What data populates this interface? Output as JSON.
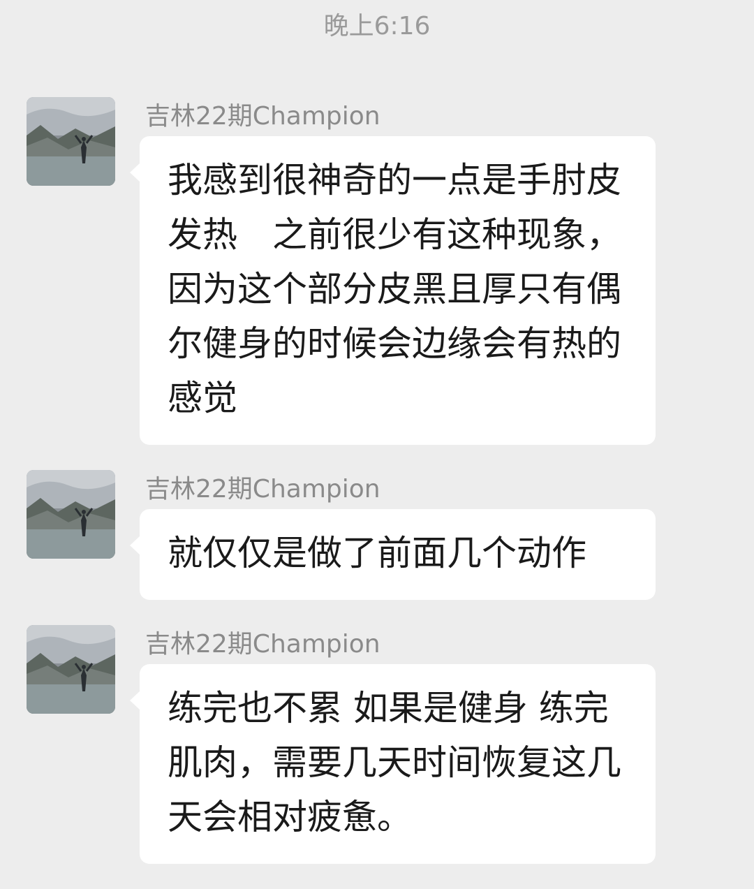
{
  "chat": {
    "timestamp": "晚上6:16",
    "messages": [
      {
        "sender": "吉林22期Champion",
        "text": "我感到很神奇的一点是手肘皮发热　之前很少有这种现象，因为这个部分皮黑且厚只有偶尔健身的时候会边缘会有热的感觉"
      },
      {
        "sender": "吉林22期Champion",
        "text": "就仅仅是做了前面几个动作"
      },
      {
        "sender": "吉林22期Champion",
        "text": "练完也不累 如果是健身 练完肌肉，需要几天时间恢复这几天会相对疲惫。"
      }
    ]
  },
  "icons": {
    "avatar": "avatar-landscape-photo"
  }
}
